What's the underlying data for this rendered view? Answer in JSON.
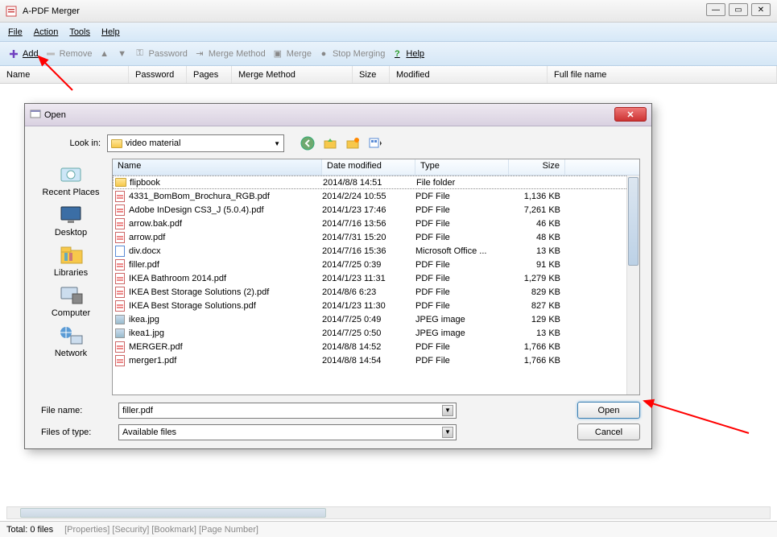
{
  "app": {
    "title": "A-PDF Merger"
  },
  "menu": {
    "file": "File",
    "action": "Action",
    "tools": "Tools",
    "help": "Help"
  },
  "toolbar": {
    "add": "Add",
    "remove": "Remove",
    "password": "Password",
    "merge_method": "Merge Method",
    "merge": "Merge",
    "stop_merging": "Stop Merging",
    "help": "Help"
  },
  "columns": {
    "name": "Name",
    "password": "Password",
    "pages": "Pages",
    "merge_method": "Merge Method",
    "size": "Size",
    "modified": "Modified",
    "full": "Full file name"
  },
  "dialog": {
    "title": "Open",
    "lookin_label": "Look in:",
    "lookin_value": "video material",
    "places": {
      "recent": "Recent Places",
      "desktop": "Desktop",
      "libraries": "Libraries",
      "computer": "Computer",
      "network": "Network"
    },
    "headers": {
      "name": "Name",
      "date": "Date modified",
      "type": "Type",
      "size": "Size"
    },
    "files": [
      {
        "icon": "folder",
        "name": "flipbook",
        "date": "2014/8/8 14:51",
        "type": "File folder",
        "size": ""
      },
      {
        "icon": "pdf",
        "name": "4331_BomBom_Brochura_RGB.pdf",
        "date": "2014/2/24 10:55",
        "type": "PDF File",
        "size": "1,136 KB"
      },
      {
        "icon": "pdf",
        "name": "Adobe InDesign CS3_J (5.0.4).pdf",
        "date": "2014/1/23 17:46",
        "type": "PDF File",
        "size": "7,261 KB"
      },
      {
        "icon": "pdf",
        "name": "arrow.bak.pdf",
        "date": "2014/7/16 13:56",
        "type": "PDF File",
        "size": "46 KB"
      },
      {
        "icon": "pdf",
        "name": "arrow.pdf",
        "date": "2014/7/31 15:20",
        "type": "PDF File",
        "size": "48 KB"
      },
      {
        "icon": "doc",
        "name": "div.docx",
        "date": "2014/7/16 15:36",
        "type": "Microsoft Office ...",
        "size": "13 KB"
      },
      {
        "icon": "pdf",
        "name": "filler.pdf",
        "date": "2014/7/25 0:39",
        "type": "PDF File",
        "size": "91 KB"
      },
      {
        "icon": "pdf",
        "name": "IKEA Bathroom 2014.pdf",
        "date": "2014/1/23 11:31",
        "type": "PDF File",
        "size": "1,279 KB"
      },
      {
        "icon": "pdf",
        "name": "IKEA Best Storage Solutions (2).pdf",
        "date": "2014/8/6 6:23",
        "type": "PDF File",
        "size": "829 KB"
      },
      {
        "icon": "pdf",
        "name": "IKEA Best Storage Solutions.pdf",
        "date": "2014/1/23 11:30",
        "type": "PDF File",
        "size": "827 KB"
      },
      {
        "icon": "jpg",
        "name": "ikea.jpg",
        "date": "2014/7/25 0:49",
        "type": "JPEG image",
        "size": "129 KB"
      },
      {
        "icon": "jpg",
        "name": "ikea1.jpg",
        "date": "2014/7/25 0:50",
        "type": "JPEG image",
        "size": "13 KB"
      },
      {
        "icon": "pdf",
        "name": "MERGER.pdf",
        "date": "2014/8/8 14:52",
        "type": "PDF File",
        "size": "1,766 KB"
      },
      {
        "icon": "pdf",
        "name": "merger1.pdf",
        "date": "2014/8/8 14:54",
        "type": "PDF File",
        "size": "1,766 KB"
      }
    ],
    "filename_label": "File name:",
    "filename_value": "filler.pdf",
    "filetype_label": "Files of type:",
    "filetype_value": "Available files",
    "open_btn": "Open",
    "cancel_btn": "Cancel"
  },
  "status": {
    "total": "Total: 0 files",
    "tabs": "[Properties] [Security] [Bookmark] [Page Number]"
  }
}
